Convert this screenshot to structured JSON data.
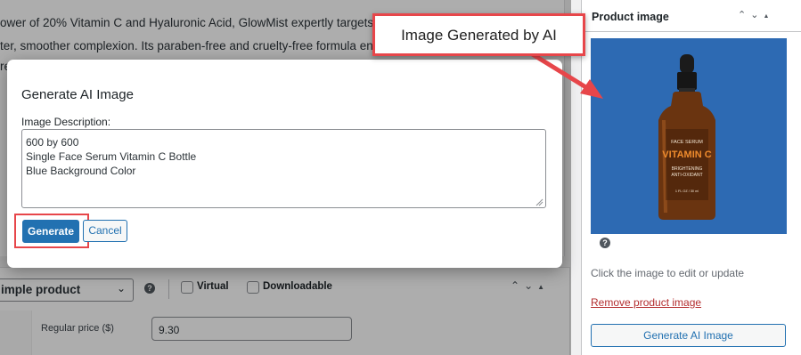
{
  "editor": {
    "line1": "ower of 20% Vitamin C and Hyaluronic Acid, GlowMist expertly targets stub",
    "line2": "ter, smoother complexion. Its paraben-free and cruelty-free formula ensure",
    "line3": "re"
  },
  "product_data": {
    "type_value": "imple product",
    "virtual_label": "Virtual",
    "downloadable_label": "Downloadable",
    "regular_price_label": "Regular price ($)",
    "regular_price_value": "9.30"
  },
  "product_image_panel": {
    "title": "Product image",
    "photo": {
      "label_top": "FACE SERUM",
      "label_main": "VITAMIN C",
      "label_sub1": "BRIGHTENING",
      "label_sub2": "ANTI-OXIDANT",
      "label_size": "1 FL OZ / 30 ml"
    },
    "click_hint": "Click the image to edit or update",
    "remove_link": "Remove product image",
    "generate_button": "Generate AI Image"
  },
  "modal": {
    "title": "Generate AI Image",
    "field_label": "Image Description:",
    "description_lines": [
      "600 by 600",
      "Single Face Serum Vitamin C Bottle",
      "Blue Background Color"
    ],
    "generate_label": "Generate",
    "cancel_label": "Cancel"
  },
  "callout": {
    "text": "Image Generated by AI"
  },
  "colors": {
    "accent": "#2271b1",
    "highlight": "#e7464a",
    "photo_background": "#2d6ab3",
    "link_red": "#b32d2e"
  },
  "icons": [
    "chevron-down-icon",
    "help-icon",
    "arrow-up-icon",
    "arrow-down-icon",
    "triangle-up-icon",
    "resize-handle-icon",
    "callout-arrow-icon"
  ]
}
